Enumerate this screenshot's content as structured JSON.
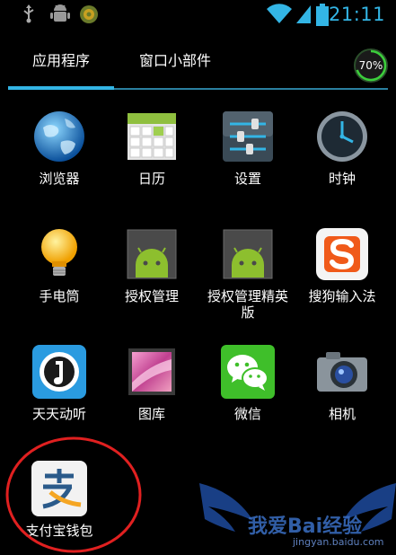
{
  "status_bar": {
    "time": "21:11",
    "icons": [
      "usb-icon",
      "android-debug-icon",
      "notification-icon",
      "wifi-icon",
      "signal-icon",
      "battery-icon"
    ]
  },
  "tabs": {
    "apps_label": "应用程序",
    "widgets_label": "窗口小部件"
  },
  "storage_badge": {
    "label": "70%",
    "percent": 70
  },
  "apps": [
    {
      "label": "浏览器",
      "icon": "browser-icon"
    },
    {
      "label": "日历",
      "icon": "calendar-icon"
    },
    {
      "label": "设置",
      "icon": "settings-icon"
    },
    {
      "label": "时钟",
      "icon": "clock-icon"
    },
    {
      "label": "手电筒",
      "icon": "flashlight-icon"
    },
    {
      "label": "授权管理",
      "icon": "android-icon"
    },
    {
      "label": "授权管理精英版",
      "icon": "android-icon"
    },
    {
      "label": "搜狗输入法",
      "icon": "sogou-icon"
    },
    {
      "label": "天天动听",
      "icon": "music-player-icon"
    },
    {
      "label": "图库",
      "icon": "gallery-icon"
    },
    {
      "label": "微信",
      "icon": "wechat-icon"
    },
    {
      "label": "相机",
      "icon": "camera-icon"
    },
    {
      "label": "支付宝钱包",
      "icon": "alipay-icon"
    }
  ],
  "colors": {
    "accent": "#33b5e5",
    "highlight_circle": "#e02020",
    "background": "#000000"
  },
  "watermark": {
    "text": "我爱Bai经验",
    "url": "jingyan.baidu.com"
  }
}
